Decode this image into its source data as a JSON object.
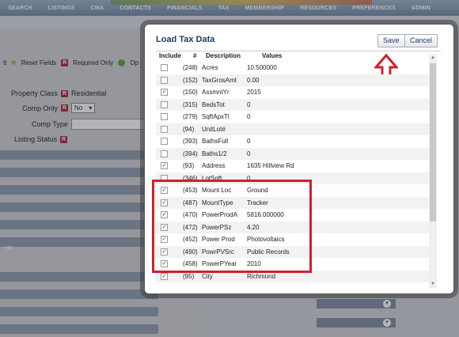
{
  "nav": [
    "SEARCH",
    "LISTINGS",
    "CMA",
    "CONTACTS",
    "FINANCIALS",
    "TAX",
    "MEMBERSHIP",
    "RESOURCES",
    "PREFERENCES",
    "ADMIN"
  ],
  "filterbar": {
    "fragment": "tl",
    "reset_fields": "Reset Fields",
    "required_only": "Required Only",
    "op_fragment": "Op"
  },
  "form": {
    "property_class_label": "Property Class",
    "property_class_value": "Residential",
    "comp_only_label": "Comp Only",
    "comp_only_value": "No",
    "comp_type_label": "Comp Type",
    "listing_status_label": "Listing Status",
    "badge": "R"
  },
  "left_fragment": "ver.",
  "dialog": {
    "title": "Load Tax Data",
    "save": "Save",
    "cancel": "Cancel",
    "columns": {
      "include": "Include",
      "num": "#",
      "desc": "Description",
      "values": "Values"
    },
    "rows": [
      {
        "checked": false,
        "num": "(248)",
        "desc": "Acres",
        "val": "10.500000"
      },
      {
        "checked": false,
        "num": "(152)",
        "desc": "TaxGrosAmt",
        "val": "0.00"
      },
      {
        "checked": true,
        "num": "(150)",
        "desc": "AssmntYr",
        "val": "2015"
      },
      {
        "checked": false,
        "num": "(315)",
        "desc": "BedsTot",
        "val": "0"
      },
      {
        "checked": false,
        "num": "(279)",
        "desc": "SqftApxTl",
        "val": "0"
      },
      {
        "checked": false,
        "num": "(94)",
        "desc": "UnitLot#",
        "val": ""
      },
      {
        "checked": false,
        "num": "(393)",
        "desc": "BathsFull",
        "val": "0"
      },
      {
        "checked": false,
        "num": "(394)",
        "desc": "Baths1/2",
        "val": "0"
      },
      {
        "checked": true,
        "num": "(93)",
        "desc": "Address",
        "val": "1635  Hillview  Rd"
      },
      {
        "checked": false,
        "num": "(346)",
        "desc": "LotSqft",
        "val": "0"
      },
      {
        "checked": true,
        "num": "(453)",
        "desc": "Mount Loc",
        "val": "Ground"
      },
      {
        "checked": true,
        "num": "(487)",
        "desc": "MountType",
        "val": "Tracker"
      },
      {
        "checked": true,
        "num": "(470)",
        "desc": "PowerProdA",
        "val": "5816.000000"
      },
      {
        "checked": true,
        "num": "(472)",
        "desc": "PowerPSz",
        "val": "4.20"
      },
      {
        "checked": true,
        "num": "(452)",
        "desc": "Power Prod",
        "val": "Photovoltaics"
      },
      {
        "checked": true,
        "num": "(490)",
        "desc": "PowrPVSrc",
        "val": "Public Records"
      },
      {
        "checked": true,
        "num": "(458)",
        "desc": "PowerPYear",
        "val": "2010"
      },
      {
        "checked": true,
        "num": "(95)",
        "desc": "City",
        "val": "Richmond"
      }
    ]
  },
  "colors": {
    "highlight": "#d0202a",
    "title": "#1f3c62",
    "badge": "#b3263a"
  }
}
